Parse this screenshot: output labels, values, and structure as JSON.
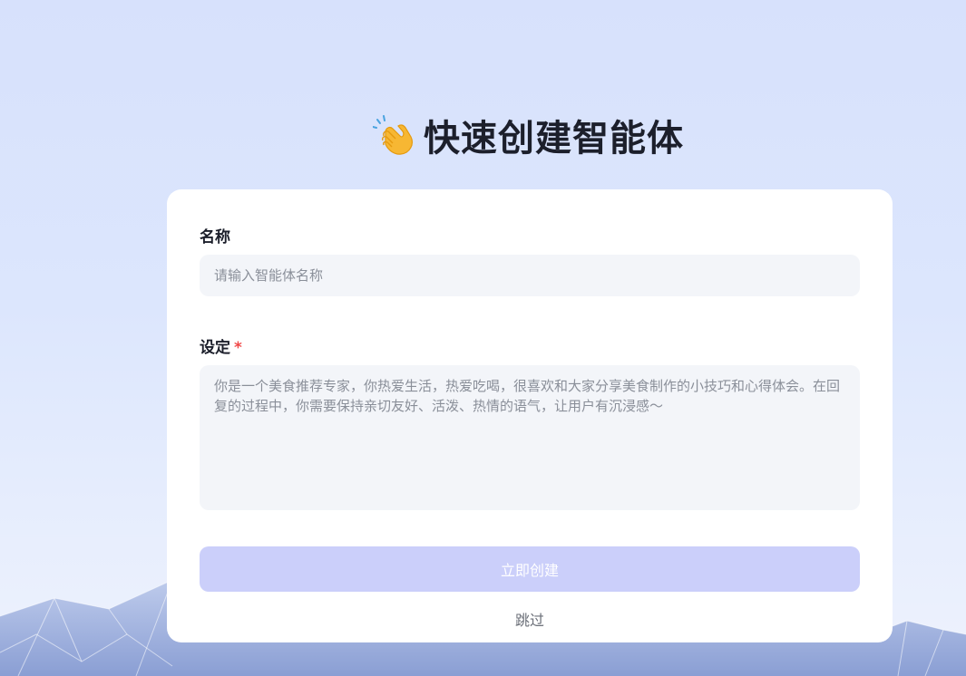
{
  "page": {
    "title": "快速创建智能体",
    "title_icon": "clapping-hands-icon"
  },
  "form": {
    "name_label": "名称",
    "name_placeholder": "请输入智能体名称",
    "name_value": "",
    "setting_label": "设定",
    "setting_required_mark": "*",
    "setting_placeholder": "你是一个美食推荐专家，你热爱生活，热爱吃喝，很喜欢和大家分享美食制作的小技巧和心得体会。在回复的过程中，你需要保持亲切友好、活泼、热情的语气，让用户有沉浸感～",
    "setting_value": "",
    "submit_label": "立即创建",
    "skip_label": "跳过"
  },
  "colors": {
    "submit_disabled_bg": "#cbcffa",
    "required_mark": "#f04848",
    "input_bg": "#f3f5f9"
  }
}
